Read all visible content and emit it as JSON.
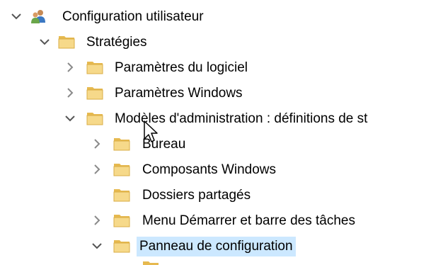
{
  "tree": {
    "items": [
      {
        "label": "Configuration utilisateur",
        "icon": "users-icon",
        "chevron": "expanded"
      },
      {
        "label": "Stratégies",
        "icon": "folder-icon",
        "chevron": "expanded"
      },
      {
        "label": "Paramètres du logiciel",
        "icon": "folder-icon",
        "chevron": "collapsed"
      },
      {
        "label": "Paramètres Windows",
        "icon": "folder-icon",
        "chevron": "collapsed"
      },
      {
        "label": "Modèles d'administration : définitions de st",
        "icon": "folder-icon",
        "chevron": "expanded"
      },
      {
        "label": "Bureau",
        "icon": "folder-icon",
        "chevron": "collapsed"
      },
      {
        "label": "Composants Windows",
        "icon": "folder-icon",
        "chevron": "collapsed"
      },
      {
        "label": "Dossiers partagés",
        "icon": "folder-icon",
        "chevron": "none"
      },
      {
        "label": "Menu Démarrer et barre des tâches",
        "icon": "folder-icon",
        "chevron": "collapsed"
      },
      {
        "label": "Panneau de configuration",
        "icon": "folder-icon",
        "chevron": "expanded",
        "selected": true
      }
    ]
  },
  "colors": {
    "selection": "#cce8ff",
    "folder": "#f3d27a",
    "folder_dark": "#d9ad45",
    "chevron": "#666666"
  }
}
